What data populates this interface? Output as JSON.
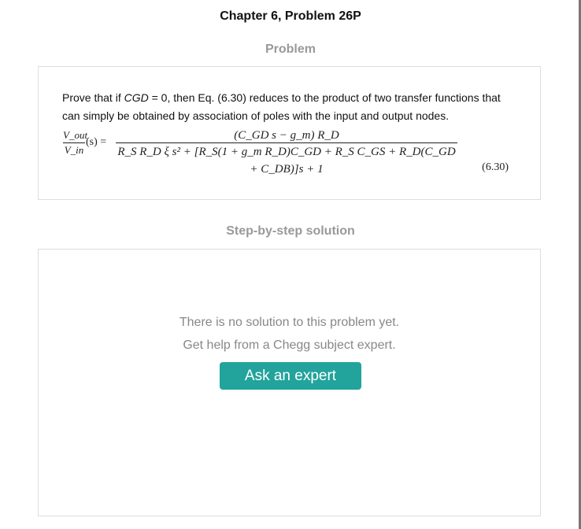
{
  "header": {
    "title": "Chapter 6, Problem 26P"
  },
  "problem": {
    "heading": "Problem",
    "text_prefix": "Prove that if ",
    "text_var": "CGD",
    "text_suffix": " = 0, then Eq. (6.30) reduces to the product of two transfer functions that can simply be obtained by association of poles with the input and output nodes.",
    "equation": {
      "lhs_numerator": "V_out",
      "lhs_denominator": "V_in",
      "lhs_rest": "(s) =",
      "rhs_numerator": "(C_GD s − g_m) R_D",
      "rhs_denominator": "R_S R_D ξ s² + [R_S(1 + g_m R_D)C_GD + R_S C_GS + R_D(C_GD + C_DB)]s + 1",
      "number": "(6.30)"
    }
  },
  "solution": {
    "heading": "Step-by-step solution",
    "empty_line1": "There is no solution to this problem yet.",
    "empty_line2": "Get help from a Chegg subject expert.",
    "button_label": "Ask an expert",
    "button_color": "#22a39b"
  }
}
